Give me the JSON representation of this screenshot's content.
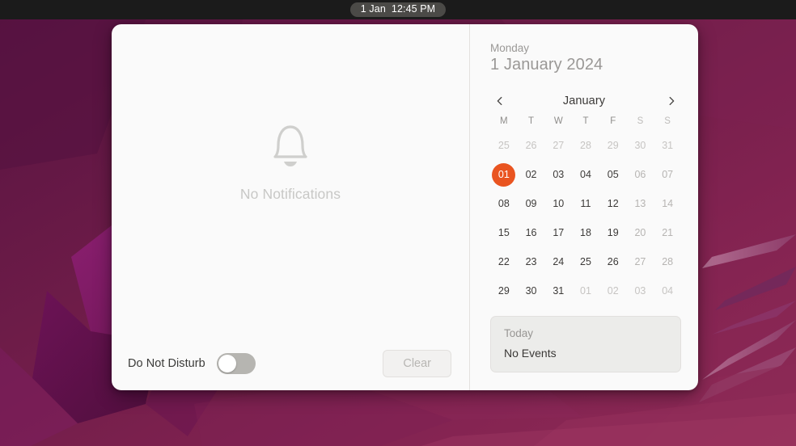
{
  "topbar": {
    "clock_date": "1 Jan",
    "clock_time": "12:45 PM"
  },
  "notifications": {
    "empty_icon": "bell-icon",
    "empty_label": "No Notifications",
    "do_not_disturb_label": "Do Not Disturb",
    "do_not_disturb_state": "off",
    "clear_label": "Clear",
    "clear_enabled": "false"
  },
  "calendar": {
    "weekday": "Monday",
    "full_date": "1 January 2024",
    "prev_icon": "chevron-left-icon",
    "next_icon": "chevron-right-icon",
    "month_label": "January",
    "weekday_headers": [
      {
        "label": "M",
        "weekend": false
      },
      {
        "label": "T",
        "weekend": false
      },
      {
        "label": "W",
        "weekend": false
      },
      {
        "label": "T",
        "weekend": false
      },
      {
        "label": "F",
        "weekend": false
      },
      {
        "label": "S",
        "weekend": true
      },
      {
        "label": "S",
        "weekend": true
      }
    ],
    "days": [
      {
        "label": "25",
        "type": "other"
      },
      {
        "label": "26",
        "type": "other"
      },
      {
        "label": "27",
        "type": "other"
      },
      {
        "label": "28",
        "type": "other"
      },
      {
        "label": "29",
        "type": "other"
      },
      {
        "label": "30",
        "type": "other"
      },
      {
        "label": "31",
        "type": "other"
      },
      {
        "label": "01",
        "type": "today"
      },
      {
        "label": "02",
        "type": "normal"
      },
      {
        "label": "03",
        "type": "normal"
      },
      {
        "label": "04",
        "type": "normal"
      },
      {
        "label": "05",
        "type": "normal"
      },
      {
        "label": "06",
        "type": "weekend"
      },
      {
        "label": "07",
        "type": "weekend"
      },
      {
        "label": "08",
        "type": "normal"
      },
      {
        "label": "09",
        "type": "normal"
      },
      {
        "label": "10",
        "type": "normal"
      },
      {
        "label": "11",
        "type": "normal"
      },
      {
        "label": "12",
        "type": "normal"
      },
      {
        "label": "13",
        "type": "weekend"
      },
      {
        "label": "14",
        "type": "weekend"
      },
      {
        "label": "15",
        "type": "normal"
      },
      {
        "label": "16",
        "type": "normal"
      },
      {
        "label": "17",
        "type": "normal"
      },
      {
        "label": "18",
        "type": "normal"
      },
      {
        "label": "19",
        "type": "normal"
      },
      {
        "label": "20",
        "type": "weekend"
      },
      {
        "label": "21",
        "type": "weekend"
      },
      {
        "label": "22",
        "type": "normal"
      },
      {
        "label": "23",
        "type": "normal"
      },
      {
        "label": "24",
        "type": "normal"
      },
      {
        "label": "25",
        "type": "normal"
      },
      {
        "label": "26",
        "type": "normal"
      },
      {
        "label": "27",
        "type": "weekend"
      },
      {
        "label": "28",
        "type": "weekend"
      },
      {
        "label": "29",
        "type": "normal"
      },
      {
        "label": "30",
        "type": "normal"
      },
      {
        "label": "31",
        "type": "normal"
      },
      {
        "label": "01",
        "type": "other"
      },
      {
        "label": "02",
        "type": "other"
      },
      {
        "label": "03",
        "type": "other"
      },
      {
        "label": "04",
        "type": "other"
      }
    ],
    "events": {
      "title": "Today",
      "body": "No Events"
    }
  },
  "colors": {
    "accent_orange": "#e95420",
    "panel_background": "#fafafa",
    "topbar_background": "#1b1b1b",
    "clock_pill": "#4b4a47",
    "wallpaper_base": "#7a2050",
    "events_box": "#ececea"
  }
}
